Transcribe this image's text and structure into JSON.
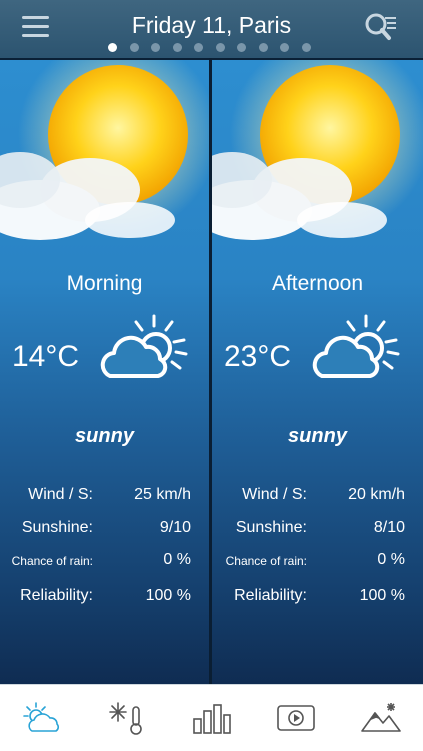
{
  "header": {
    "title": "Friday 11, Paris",
    "page_count": 10,
    "active_page": 1
  },
  "panels": [
    {
      "period": "Morning",
      "temperature": "14°C",
      "description": "sunny",
      "wind_label": "Wind / S:",
      "wind_value": "25 km/h",
      "sunshine_label": "Sunshine:",
      "sunshine_value": "9/10",
      "rain_label": "Chance of rain:",
      "rain_value": "0 %",
      "reliability_label": "Reliability:",
      "reliability_value": "100 %"
    },
    {
      "period": "Afternoon",
      "temperature": "23°C",
      "description": "sunny",
      "wind_label": "Wind / S:",
      "wind_value": "20 km/h",
      "sunshine_label": "Sunshine:",
      "sunshine_value": "8/10",
      "rain_label": "Chance of rain:",
      "rain_value": "0 %",
      "reliability_label": "Reliability:",
      "reliability_value": "100 %"
    }
  ],
  "tabs": [
    {
      "icon": "partly-sunny-icon",
      "active": true
    },
    {
      "icon": "snow-thermometer-icon",
      "active": false
    },
    {
      "icon": "bar-chart-icon",
      "active": false
    },
    {
      "icon": "video-play-icon",
      "active": false
    },
    {
      "icon": "mountain-icon",
      "active": false
    }
  ],
  "colors": {
    "accent": "#29a3d6",
    "inactive_icon": "#555555",
    "header_bg": "#3a607a"
  }
}
